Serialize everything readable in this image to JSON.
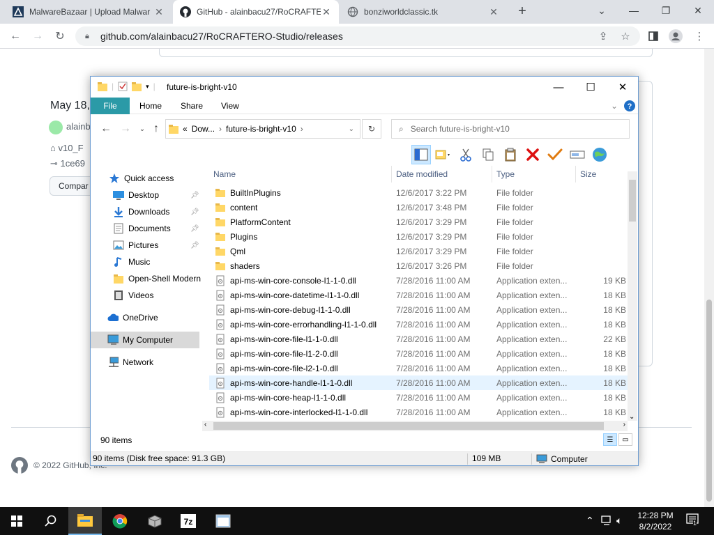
{
  "browser": {
    "tabs": [
      {
        "title": "MalwareBazaar | Upload Malwar",
        "active": false
      },
      {
        "title": "GitHub - alainbacu27/RoCRAFTE",
        "active": true
      },
      {
        "title": "bonziworldclassic.tk",
        "active": false
      }
    ],
    "new_tab": "+",
    "url": "github.com/alainbacu27/RoCRAFTERO-Studio/releases"
  },
  "github": {
    "date": "May 18,",
    "author": "alainb",
    "tag": "v10_F",
    "commit": "1ce69",
    "compare_label": "Compar",
    "footer": "© 2022 GitHub, Inc."
  },
  "explorer": {
    "title": "future-is-bright-v10",
    "ribbon_tabs": [
      "File",
      "Home",
      "Share",
      "View"
    ],
    "breadcrumb": [
      "Dow...",
      "future-is-bright-v10"
    ],
    "breadcrumb_prefix": "«",
    "search_placeholder": "Search future-is-bright-v10",
    "columns": [
      "Name",
      "Date modified",
      "Type",
      "Size"
    ],
    "nav": [
      {
        "label": "Quick access",
        "icon": "star-icon"
      },
      {
        "label": "Desktop",
        "icon": "desktop-icon",
        "pinned": true
      },
      {
        "label": "Downloads",
        "icon": "download-icon",
        "pinned": true
      },
      {
        "label": "Documents",
        "icon": "documents-icon",
        "pinned": true
      },
      {
        "label": "Pictures",
        "icon": "pictures-icon",
        "pinned": true
      },
      {
        "label": "Music",
        "icon": "music-icon"
      },
      {
        "label": "Open-Shell Modern",
        "icon": "folder-icon"
      },
      {
        "label": "Videos",
        "icon": "videos-icon"
      },
      {
        "label": "OneDrive",
        "icon": "cloud-icon"
      },
      {
        "label": "My Computer",
        "icon": "computer-icon",
        "selected": true
      },
      {
        "label": "Network",
        "icon": "network-icon"
      }
    ],
    "files": [
      {
        "name": "BuiltInPlugins",
        "date": "12/6/2017 3:22 PM",
        "type": "File folder",
        "size": "",
        "kind": "folder"
      },
      {
        "name": "content",
        "date": "12/6/2017 3:48 PM",
        "type": "File folder",
        "size": "",
        "kind": "folder"
      },
      {
        "name": "PlatformContent",
        "date": "12/6/2017 3:29 PM",
        "type": "File folder",
        "size": "",
        "kind": "folder"
      },
      {
        "name": "Plugins",
        "date": "12/6/2017 3:29 PM",
        "type": "File folder",
        "size": "",
        "kind": "folder"
      },
      {
        "name": "Qml",
        "date": "12/6/2017 3:29 PM",
        "type": "File folder",
        "size": "",
        "kind": "folder"
      },
      {
        "name": "shaders",
        "date": "12/6/2017 3:26 PM",
        "type": "File folder",
        "size": "",
        "kind": "folder"
      },
      {
        "name": "api-ms-win-core-console-l1-1-0.dll",
        "date": "7/28/2016 11:00 AM",
        "type": "Application exten...",
        "size": "19 KB",
        "kind": "dll"
      },
      {
        "name": "api-ms-win-core-datetime-l1-1-0.dll",
        "date": "7/28/2016 11:00 AM",
        "type": "Application exten...",
        "size": "18 KB",
        "kind": "dll"
      },
      {
        "name": "api-ms-win-core-debug-l1-1-0.dll",
        "date": "7/28/2016 11:00 AM",
        "type": "Application exten...",
        "size": "18 KB",
        "kind": "dll"
      },
      {
        "name": "api-ms-win-core-errorhandling-l1-1-0.dll",
        "date": "7/28/2016 11:00 AM",
        "type": "Application exten...",
        "size": "18 KB",
        "kind": "dll"
      },
      {
        "name": "api-ms-win-core-file-l1-1-0.dll",
        "date": "7/28/2016 11:00 AM",
        "type": "Application exten...",
        "size": "22 KB",
        "kind": "dll"
      },
      {
        "name": "api-ms-win-core-file-l1-2-0.dll",
        "date": "7/28/2016 11:00 AM",
        "type": "Application exten...",
        "size": "18 KB",
        "kind": "dll"
      },
      {
        "name": "api-ms-win-core-file-l2-1-0.dll",
        "date": "7/28/2016 11:00 AM",
        "type": "Application exten...",
        "size": "18 KB",
        "kind": "dll"
      },
      {
        "name": "api-ms-win-core-handle-l1-1-0.dll",
        "date": "7/28/2016 11:00 AM",
        "type": "Application exten...",
        "size": "18 KB",
        "kind": "dll",
        "hover": true
      },
      {
        "name": "api-ms-win-core-heap-l1-1-0.dll",
        "date": "7/28/2016 11:00 AM",
        "type": "Application exten...",
        "size": "18 KB",
        "kind": "dll"
      },
      {
        "name": "api-ms-win-core-interlocked-l1-1-0.dll",
        "date": "7/28/2016 11:00 AM",
        "type": "Application exten...",
        "size": "18 KB",
        "kind": "dll"
      }
    ],
    "item_count": "90 items",
    "status_free": "90 items (Disk free space: 91.3 GB)",
    "status_size": "109 MB",
    "status_location": "Computer"
  },
  "taskbar": {
    "time": "12:28 PM",
    "date": "8/2/2022",
    "notification_count": "1"
  },
  "colors": {
    "file_tab": "#2b9aa7",
    "selection": "#cce8ff",
    "taskbar": "#101010"
  }
}
